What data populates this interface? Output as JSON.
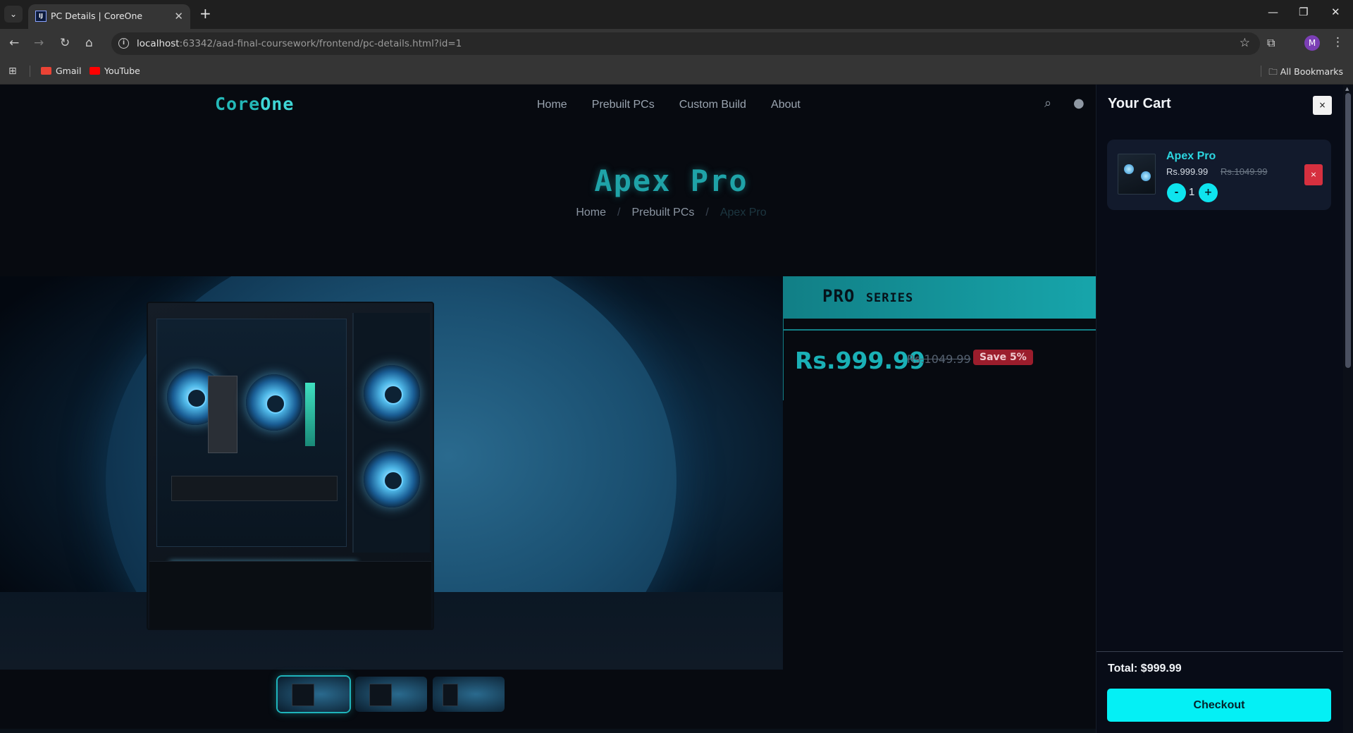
{
  "browser": {
    "tab_title": "PC Details | CoreOne",
    "url_host": "localhost",
    "url_rest": ":63342/aad-final-coursework/frontend/pc-details.html?id=1",
    "bookmarks": [
      "Gmail",
      "YouTube"
    ],
    "all_bookmarks": "All Bookmarks",
    "profile_initial": "M"
  },
  "site": {
    "logo_core": "Core",
    "logo_one": "One",
    "nav": [
      "Home",
      "Prebuilt PCs",
      "Custom Build",
      "About"
    ]
  },
  "product": {
    "title": "Apex Pro",
    "breadcrumb": [
      "Home",
      "Prebuilt PCs",
      "Apex Pro"
    ],
    "series": "PRO",
    "series_suffix": "SERIES",
    "price": "Rs.999.99",
    "old_price": "Rs.1049.99",
    "save_badge": "Save 5%",
    "thumbnail_count": 3
  },
  "cart": {
    "title": "Your Cart",
    "close": "×",
    "items": [
      {
        "name": "Apex Pro",
        "price": "Rs.999.99",
        "old_price": "Rs.1049.99",
        "quantity": "1",
        "minus": "-",
        "plus": "+",
        "remove": "×"
      }
    ],
    "total": "Total: $999.99",
    "checkout": "Checkout"
  },
  "icons": {
    "search": "search-icon",
    "user": "user-icon"
  },
  "colors": {
    "accent": "#1ab0b6",
    "cart_accent": "#04f0f5",
    "danger": "#d6303f"
  }
}
